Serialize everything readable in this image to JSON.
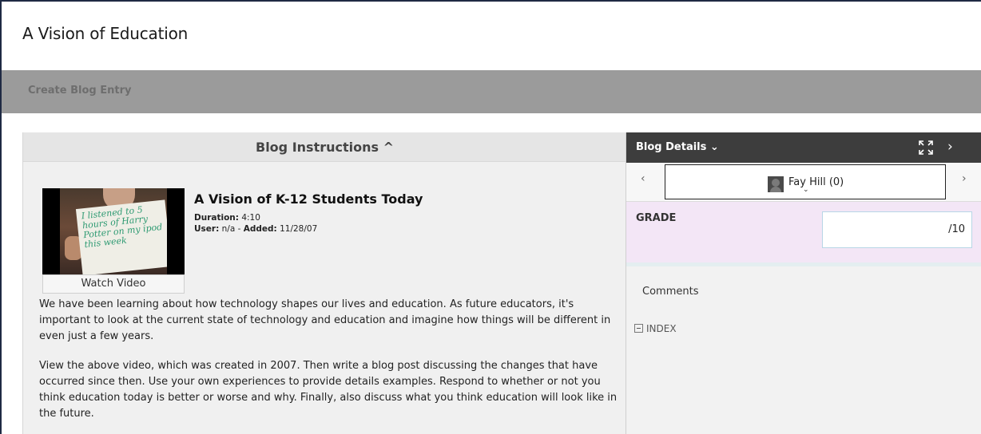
{
  "page": {
    "title": "A Vision of Education"
  },
  "toolbar": {
    "create_label": "Create Blog Entry"
  },
  "instructions": {
    "header": "Blog Instructions ^",
    "video": {
      "title": "A Vision of K-12 Students Today",
      "duration_label": "Duration:",
      "duration": "4:10",
      "user_label": "User:",
      "user": "n/a",
      "added_label": "Added:",
      "added": "11/28/07",
      "watch_label": "Watch Video",
      "sign_text": "I listened to 5 hours of Harry Potter on my ipod this week"
    },
    "paragraphs": [
      "We have been learning about how technology shapes our lives and education. As future educators, it's important to look at the current state of technology and education and imagine how things will be different in even just a few years.",
      "View the above video, which was created in 2007. Then write a blog post discussing the changes that have occurred since then. Use your own experiences to provide details examples. Respond to whether or not you think education today is better or worse and why. Finally, also discuss what you think education will look like in the future."
    ]
  },
  "details": {
    "label": "Blog Details ⌄",
    "user_name": "Fay Hill (0)",
    "grade_label": "GRADE",
    "grade_value": "/10",
    "comments_label": "Comments",
    "index_label": "INDEX"
  },
  "colors": {
    "action_bar": "#9b9b9b",
    "details_bar": "#3d3d3d",
    "grade_bg": "#f3e6f6",
    "sign_text": "#2e9a72"
  },
  "icons": {
    "expand": "expand-icon",
    "next": "chevron-right-icon",
    "prev": "chevron-left-icon",
    "collapse": "minus-square-icon"
  }
}
